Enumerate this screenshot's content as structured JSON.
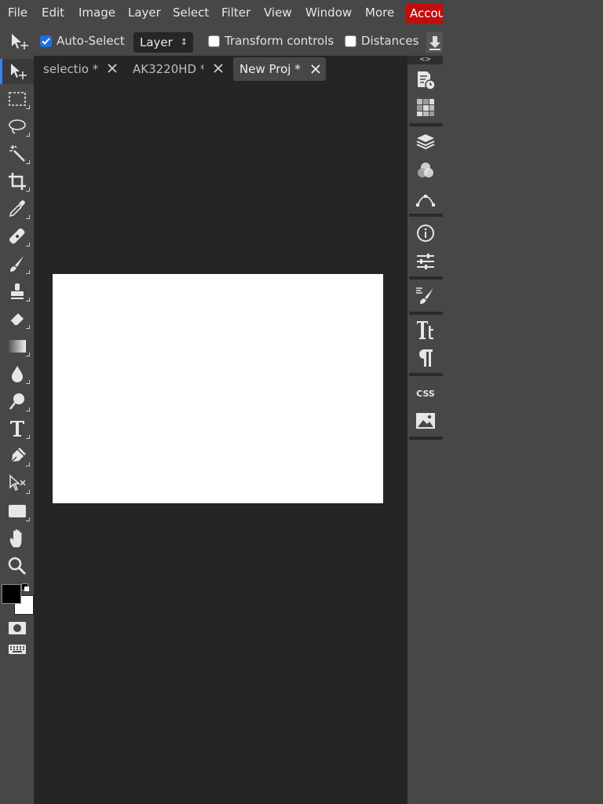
{
  "menubar": {
    "items": [
      {
        "label": "File"
      },
      {
        "label": "Edit"
      },
      {
        "label": "Image"
      },
      {
        "label": "Layer"
      },
      {
        "label": "Select"
      },
      {
        "label": "Filter"
      },
      {
        "label": "View"
      },
      {
        "label": "Window"
      },
      {
        "label": "More"
      }
    ],
    "account_label": "Accou"
  },
  "options": {
    "auto_select_label": "Auto-Select",
    "auto_select_checked": true,
    "layer_select_value": "Layer",
    "transform_label": "Transform controls",
    "transform_checked": false,
    "distances_label": "Distances",
    "distances_checked": false
  },
  "tabs": [
    {
      "label": "selectio *",
      "active": false
    },
    {
      "label": "AK3220HD *",
      "active": false
    },
    {
      "label": "New Proj *",
      "active": true
    }
  ],
  "panel_toggle": "<>",
  "colors": {
    "accent": "#3b82f6",
    "account_red": "#c20d0d",
    "foreground_swatch": "#000000",
    "background_swatch": "#ffffff",
    "canvas": "#ffffff"
  },
  "icons": {
    "tools": [
      "move-icon",
      "marquee-icon",
      "lasso-icon",
      "magic-wand-icon",
      "crop-icon",
      "eyedropper-icon",
      "healing-icon",
      "brush-icon",
      "stamp-icon",
      "eraser-icon",
      "gradient-icon",
      "blur-icon",
      "dodge-icon",
      "type-icon",
      "pen-icon",
      "path-select-icon",
      "rectangle-icon",
      "hand-icon",
      "zoom-icon"
    ],
    "right_panel": [
      "history-icon",
      "swatches-icon",
      "layers-icon",
      "channels-icon",
      "paths-icon",
      "info-icon",
      "properties-icon",
      "brush-settings-icon",
      "character-icon",
      "paragraph-icon",
      "css-icon",
      "image-icon"
    ]
  }
}
